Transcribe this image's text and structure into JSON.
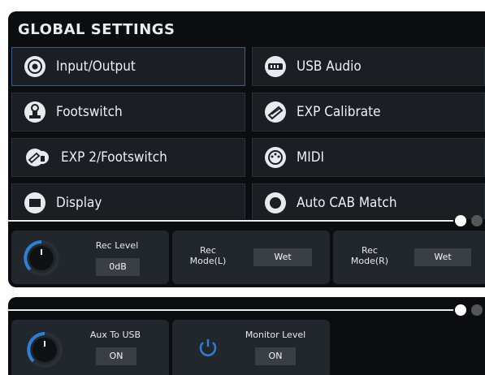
{
  "header": {
    "title": "GLOBAL SETTINGS"
  },
  "menu": {
    "items": [
      {
        "label": "Input/Output",
        "icon": "input-output-icon"
      },
      {
        "label": "USB Audio",
        "icon": "usb-audio-icon"
      },
      {
        "label": "Footswitch",
        "icon": "footswitch-icon"
      },
      {
        "label": "EXP Calibrate",
        "icon": "exp-calibrate-icon"
      },
      {
        "label": "EXP 2/Footswitch",
        "icon": "exp-footswitch-icon"
      },
      {
        "label": "MIDI",
        "icon": "midi-icon"
      },
      {
        "label": "Display",
        "icon": "display-icon"
      },
      {
        "label": "Auto CAB Match",
        "icon": "auto-cab-match-icon"
      }
    ]
  },
  "params_top": {
    "rec_level": {
      "label": "Rec Level",
      "value": "0dB"
    },
    "rec_mode_l": {
      "label_line1": "Rec",
      "label_line2": "Mode(L)",
      "value": "Wet"
    },
    "rec_mode_r": {
      "label_line1": "Rec",
      "label_line2": "Mode(R)",
      "value": "Wet"
    }
  },
  "params_bottom": {
    "aux_to_usb": {
      "label": "Aux To USB",
      "value": "ON"
    },
    "monitor_level": {
      "label": "Monitor Level",
      "value": "ON"
    }
  },
  "colors": {
    "panel": "#0b0d10",
    "button": "#1b1f24",
    "active_border": "#3d5f86",
    "knob_accent": "#2f7fd4",
    "page_dot_active": "#ffffff",
    "page_dot_inactive": "#555555"
  }
}
